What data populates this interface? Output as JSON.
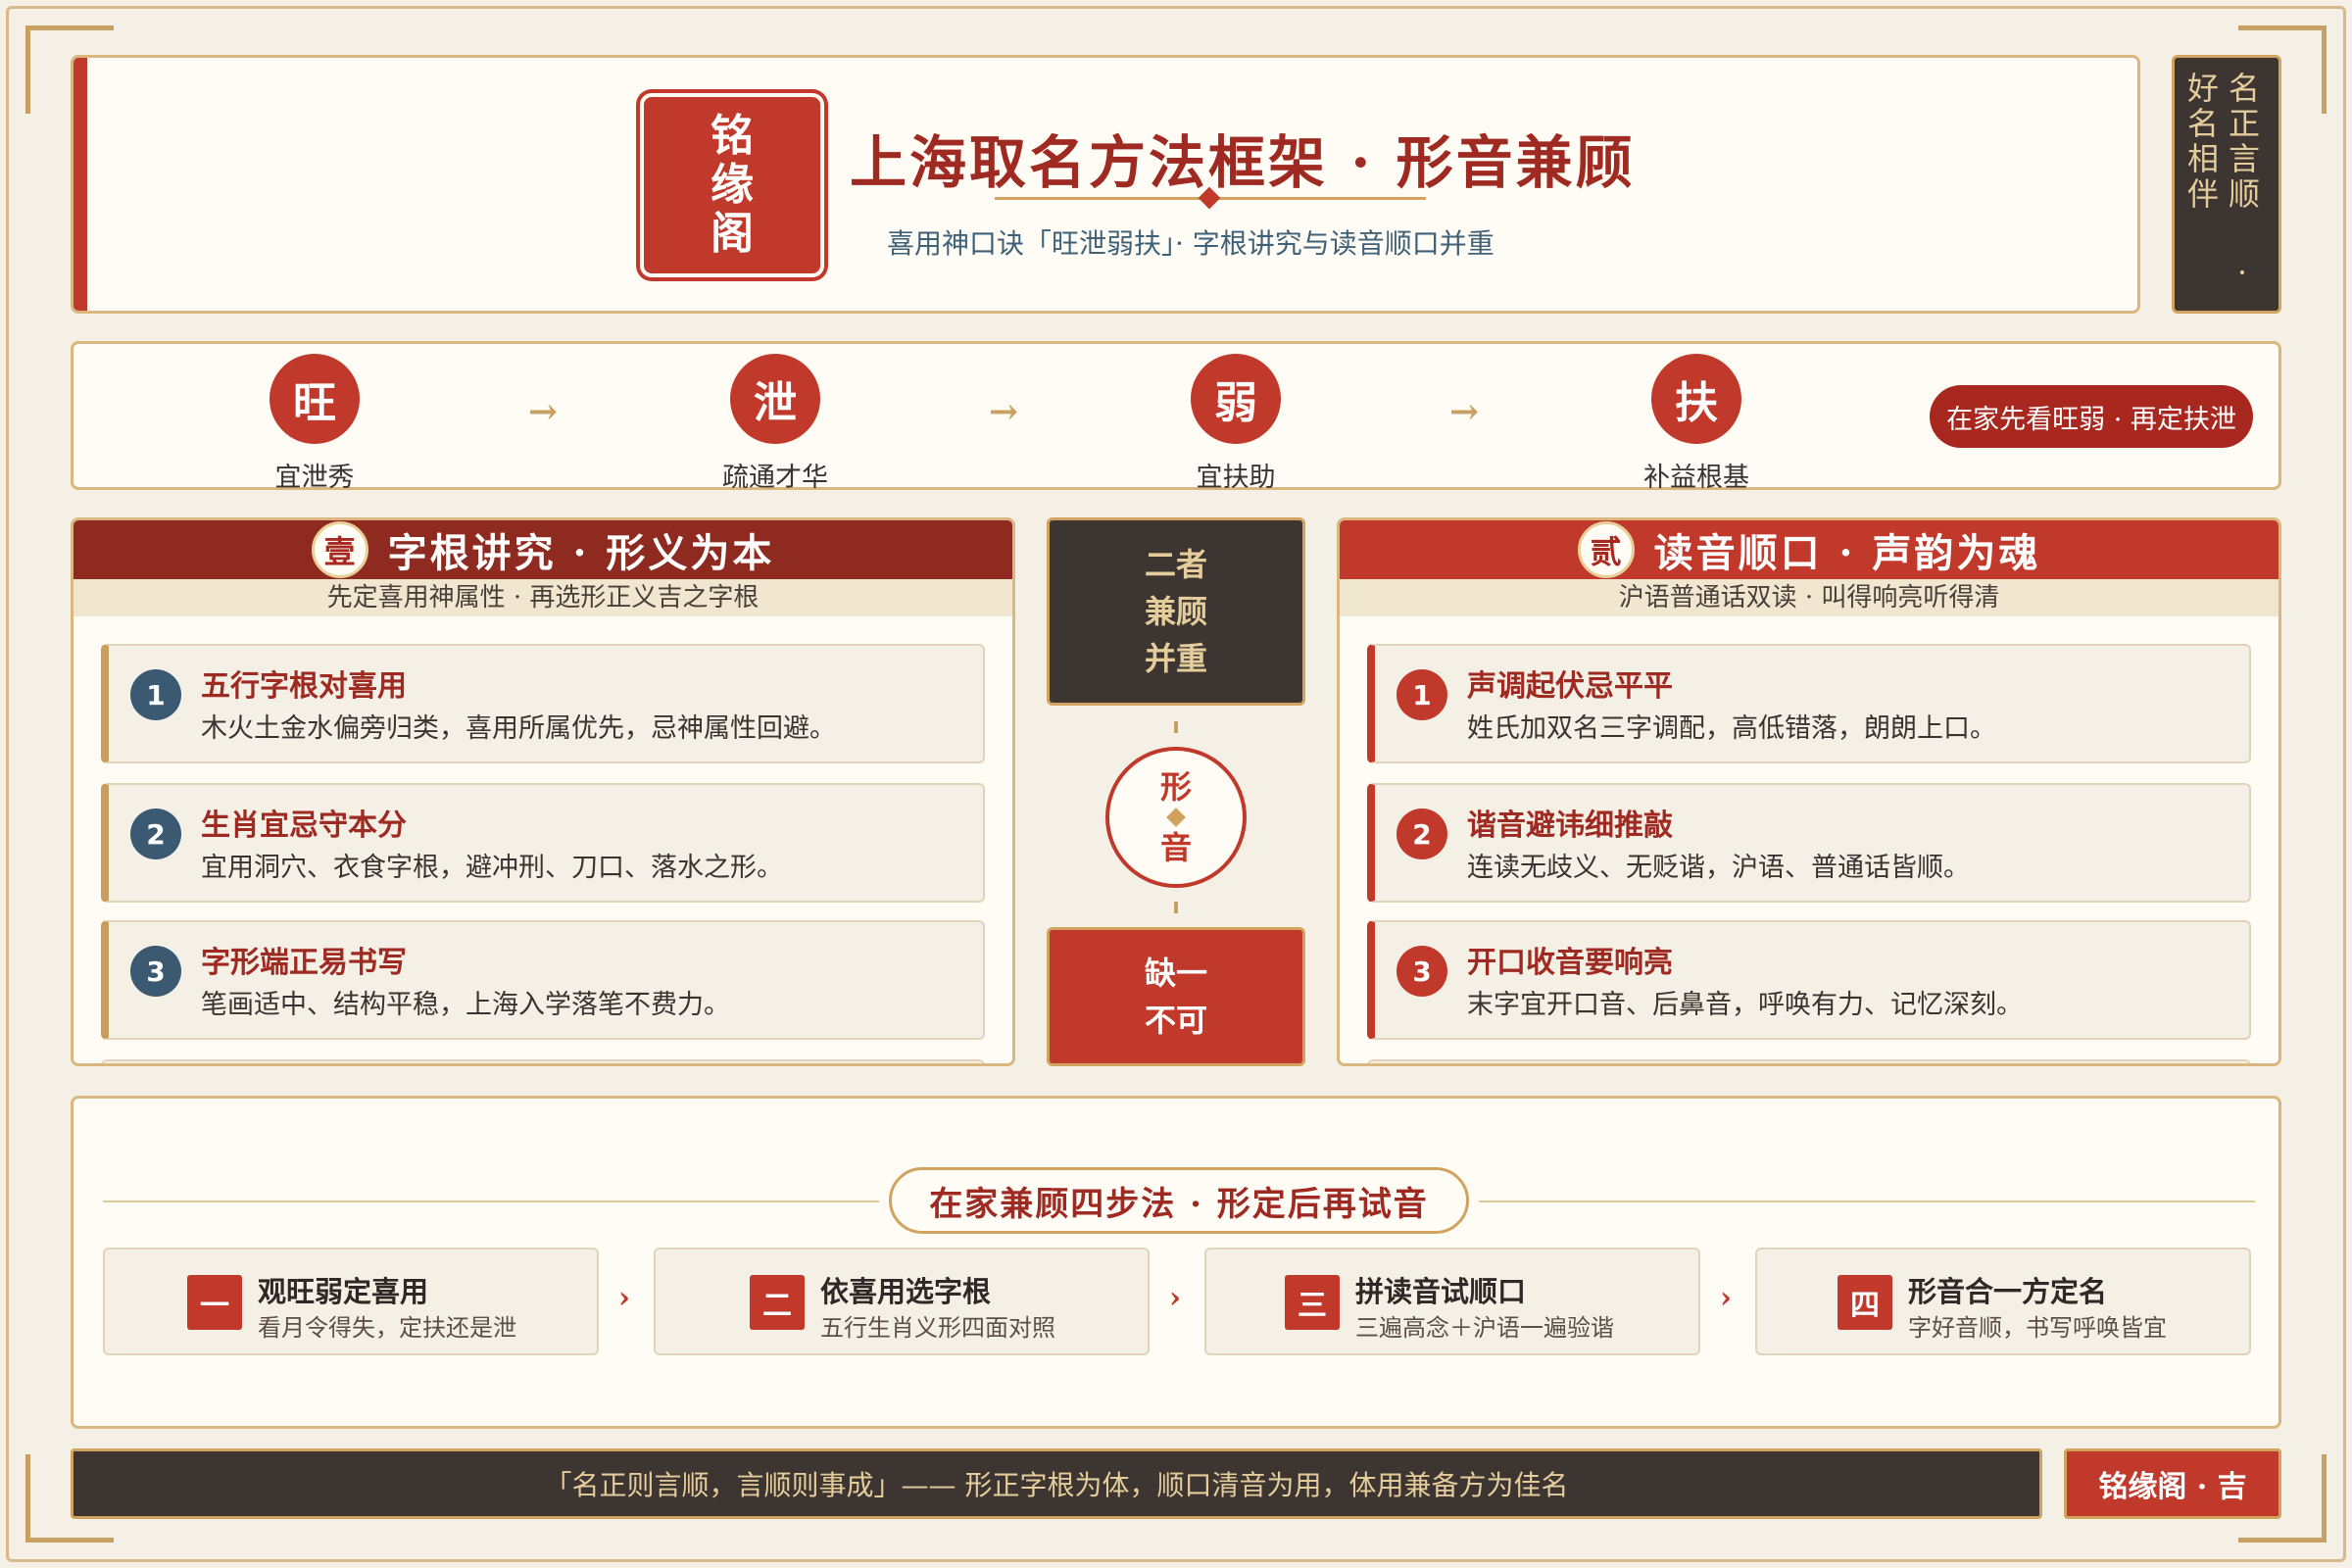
{
  "header": {
    "seal": "铭缘阁",
    "title": "上海取名方法框架 · 形音兼顾",
    "subtitle": "喜用神口诀「旺泄弱扶」· 字根讲究与读音顺口并重",
    "motto": "名正言顺 · 好名相伴"
  },
  "flow": {
    "nodes": [
      {
        "char": "旺",
        "label": "宜泄秀"
      },
      {
        "char": "泄",
        "label": "疏通才华"
      },
      {
        "char": "弱",
        "label": "宜扶助"
      },
      {
        "char": "扶",
        "label": "补益根基"
      }
    ],
    "arrow": "→",
    "pill": "在家先看旺弱 · 再定扶泄"
  },
  "left": {
    "badge": "壹",
    "title": "字根讲究 · 形义为本",
    "subtitle": "先定喜用神属性 · 再选形正义吉之字根",
    "items": [
      {
        "num": "1",
        "title": "五行字根对喜用",
        "desc": "木火土金水偏旁归类，喜用所属优先，忌神属性回避。"
      },
      {
        "num": "2",
        "title": "生肖宜忌守本分",
        "desc": "宜用洞穴、衣食字根，避冲刑、刀口、落水之形。"
      },
      {
        "num": "3",
        "title": "字形端正易书写",
        "desc": "笔画适中、结构平稳，上海入学落笔不费力。"
      }
    ]
  },
  "right": {
    "badge": "贰",
    "title": "读音顺口 · 声韵为魂",
    "subtitle": "沪语普通话双读 · 叫得响亮听得清",
    "items": [
      {
        "num": "1",
        "title": "声调起伏忌平平",
        "desc": "姓氏加双名三字调配，高低错落，朗朗上口。"
      },
      {
        "num": "2",
        "title": "谐音避讳细推敲",
        "desc": "连读无歧义、无贬谐，沪语、普通话皆顺。"
      },
      {
        "num": "3",
        "title": "开口收音要响亮",
        "desc": "末字宜开口音、后鼻音，呼唤有力、记忆深刻。"
      }
    ]
  },
  "middle": {
    "top": [
      "二者",
      "兼顾",
      "并重"
    ],
    "circle_top": "形",
    "circle_bottom": "音",
    "bottom": [
      "缺一",
      "不可"
    ]
  },
  "steps": {
    "title": "在家兼顾四步法 · 形定后再试音",
    "arrow": "›",
    "items": [
      {
        "num": "一",
        "title": "观旺弱定喜用",
        "desc": "看月令得失，定扶还是泄"
      },
      {
        "num": "二",
        "title": "依喜用选字根",
        "desc": "五行生肖义形四面对照"
      },
      {
        "num": "三",
        "title": "拼读音试顺口",
        "desc": "三遍高念＋沪语一遍验谐"
      },
      {
        "num": "四",
        "title": "形音合一方定名",
        "desc": "字好音顺，书写呼唤皆宜"
      }
    ]
  },
  "footer": {
    "quote": "「名正则言顺，言顺则事成」—— 形正字根为体，顺口清音为用，体用兼备方为佳名",
    "seal": "铭缘阁 · 吉"
  },
  "colors": {
    "accent": "#c0392b",
    "dark_red": "#8e2a20",
    "gold": "#d1a35e",
    "ink": "#3c3531",
    "paper": "#fffcf5"
  }
}
